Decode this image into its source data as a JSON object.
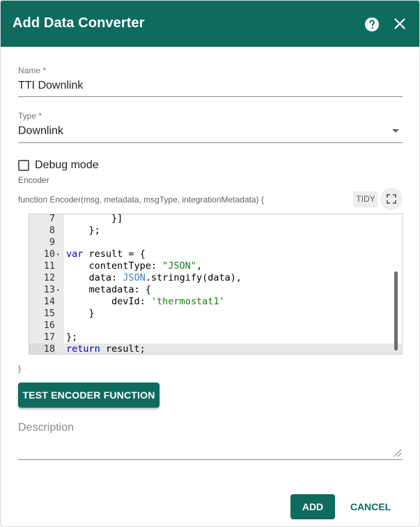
{
  "dialog": {
    "title": "Add Data Converter"
  },
  "name_field": {
    "label": "Name *",
    "value": "TTI Downlink"
  },
  "type_field": {
    "label": "Type *",
    "value": "Downlink"
  },
  "debug": {
    "label": "Debug mode",
    "checked": false
  },
  "encoder": {
    "section_label": "Encoder",
    "signature": "function Encoder(msg, metadata, msgType, integrationMetadata) {",
    "tidy_label": "TIDY",
    "closing_brace": "}",
    "code_lines": [
      {
        "n": "7",
        "text": "        }]"
      },
      {
        "n": "8",
        "text": "    };"
      },
      {
        "n": "9",
        "text": ""
      },
      {
        "n": "10",
        "text": "var result = {"
      },
      {
        "n": "11",
        "text": "    contentType: \"JSON\","
      },
      {
        "n": "12",
        "text": "    data: JSON.stringify(data),"
      },
      {
        "n": "13",
        "text": "    metadata: {"
      },
      {
        "n": "14",
        "text": "        devId: 'thermostat1'"
      },
      {
        "n": "15",
        "text": "    }"
      },
      {
        "n": "16",
        "text": ""
      },
      {
        "n": "17",
        "text": "};"
      },
      {
        "n": "18",
        "text": "return result;"
      }
    ],
    "active_line": "18"
  },
  "test_button": "TEST ENCODER FUNCTION",
  "description": {
    "placeholder": "Description"
  },
  "actions": {
    "add": "ADD",
    "cancel": "CANCEL"
  },
  "colors": {
    "primary": "#0e6b5e",
    "keyword": "#0000cd",
    "string": "#1a7a1a"
  }
}
